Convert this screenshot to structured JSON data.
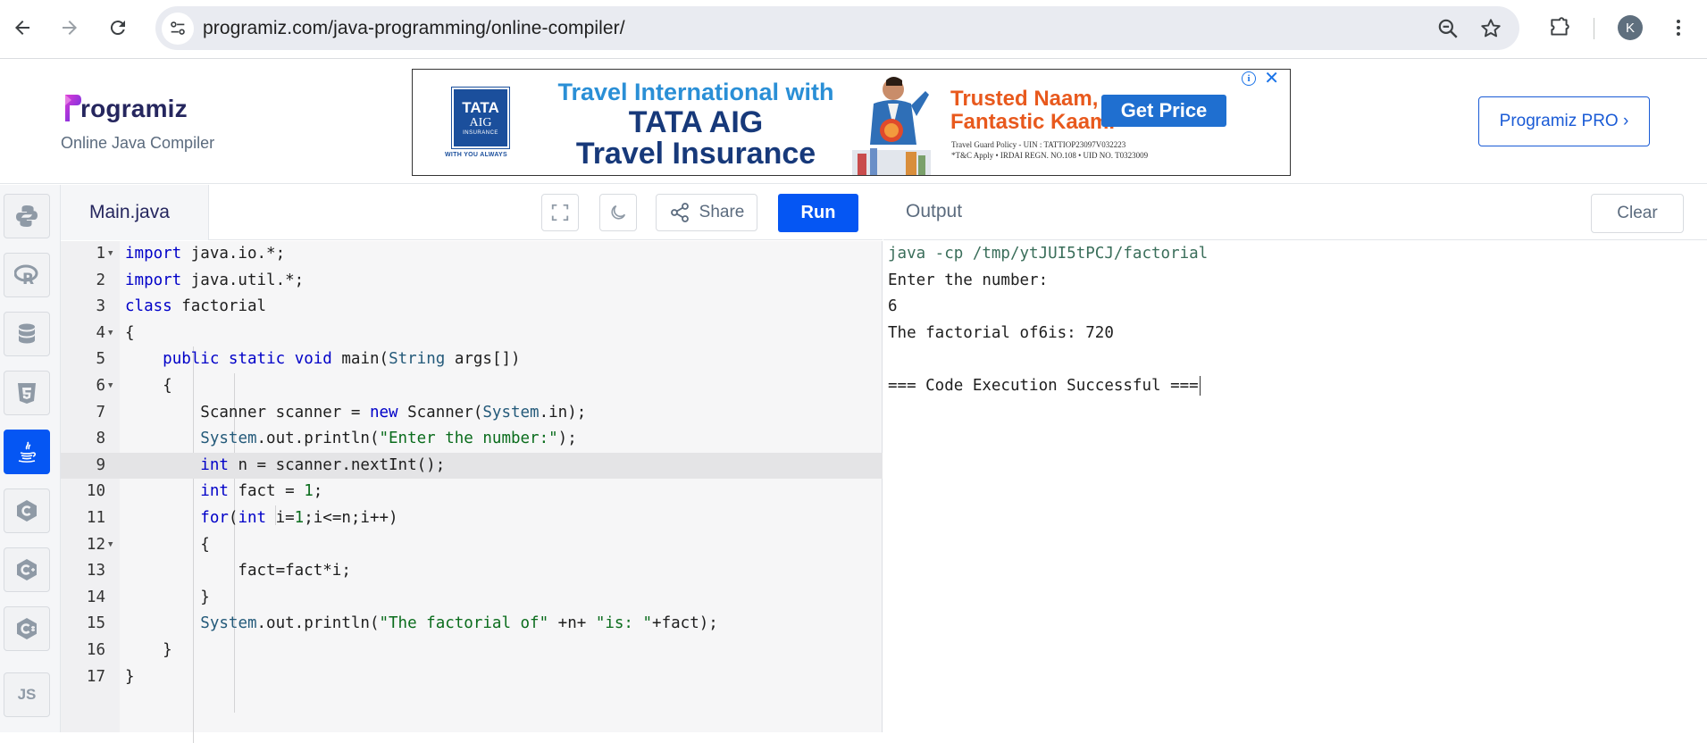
{
  "browser": {
    "url": "programiz.com/java-programming/online-compiler/",
    "profile_initial": "K"
  },
  "header": {
    "logo_text": "rogramiz",
    "subtitle": "Online Java Compiler",
    "pro_button": "Programiz PRO ›"
  },
  "ad": {
    "badge_line1": "TATA",
    "badge_line2": "AIG",
    "badge_line3": "INSURANCE",
    "tagline": "WITH YOU ALWAYS",
    "headline1": "Travel International with",
    "headline2": "TATA AIG",
    "headline3": "Travel Insurance",
    "trusted1": "Trusted Naam,",
    "trusted2": "Fantastic Kaam.",
    "cta": "Get Price",
    "fine1": "Travel Guard Policy - UIN : TATTIOP23097V032223",
    "fine2": "*T&C Apply  •  IRDAI REGN. NO.108  •  UID NO. T0323009"
  },
  "editor": {
    "file_tab": "Main.java",
    "share_label": "Share",
    "run_label": "Run",
    "current_line": 9,
    "line_numbers": [
      "1",
      "2",
      "3",
      "4",
      "5",
      "6",
      "7",
      "8",
      "9",
      "10",
      "11",
      "12",
      "13",
      "14",
      "15",
      "16",
      "17"
    ]
  },
  "output": {
    "title": "Output",
    "clear_label": "Clear",
    "lines": [
      "java -cp /tmp/ytJUI5tPCJ/factorial",
      "Enter the number:",
      "6",
      "The factorial of6is: 720",
      "",
      "=== Code Execution Successful ==="
    ]
  },
  "sidebar": {
    "items": [
      "python-icon",
      "r-icon",
      "sql-icon",
      "html5-icon",
      "java-icon",
      "c-icon",
      "cpp-icon",
      "csharp-icon",
      "js-icon"
    ],
    "js_label": "JS",
    "active": "java-icon"
  },
  "colors": {
    "accent": "#0556f3",
    "keyword": "#0000c8",
    "string": "#0a6c1c"
  }
}
